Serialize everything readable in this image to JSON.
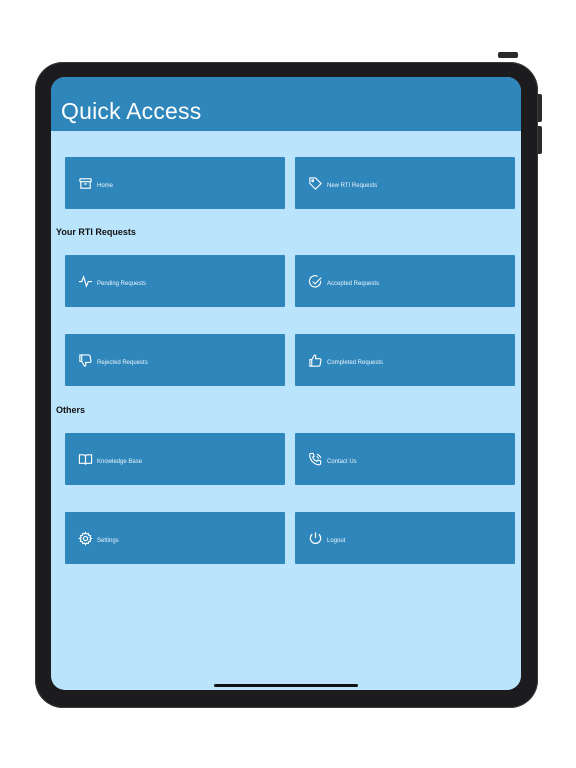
{
  "header": {
    "title": "Quick Access"
  },
  "tiles_top": [
    {
      "label": "Home",
      "icon": "archive-box-icon"
    },
    {
      "label": "New RTI Requests",
      "icon": "tag-icon"
    }
  ],
  "sections": {
    "requests_title": "Your RTI Requests",
    "others_title": "Others"
  },
  "tiles_requests": [
    {
      "label": "Pending Requests",
      "icon": "activity-pulse-icon"
    },
    {
      "label": "Accepted Requests",
      "icon": "check-circle-icon"
    },
    {
      "label": "Rejected Requests",
      "icon": "thumbs-down-icon"
    },
    {
      "label": "Completed Requests",
      "icon": "thumbs-up-icon"
    }
  ],
  "tiles_others": [
    {
      "label": "Knowledge Base",
      "icon": "book-icon"
    },
    {
      "label": "Contact Us",
      "icon": "phone-call-icon"
    },
    {
      "label": "Settings",
      "icon": "gear-icon"
    },
    {
      "label": "Logout",
      "icon": "power-icon"
    }
  ],
  "colors": {
    "header": "#2f86bb",
    "tile": "#2f86bb",
    "background": "#b9e4fb",
    "frame": "#1c1c1e"
  }
}
